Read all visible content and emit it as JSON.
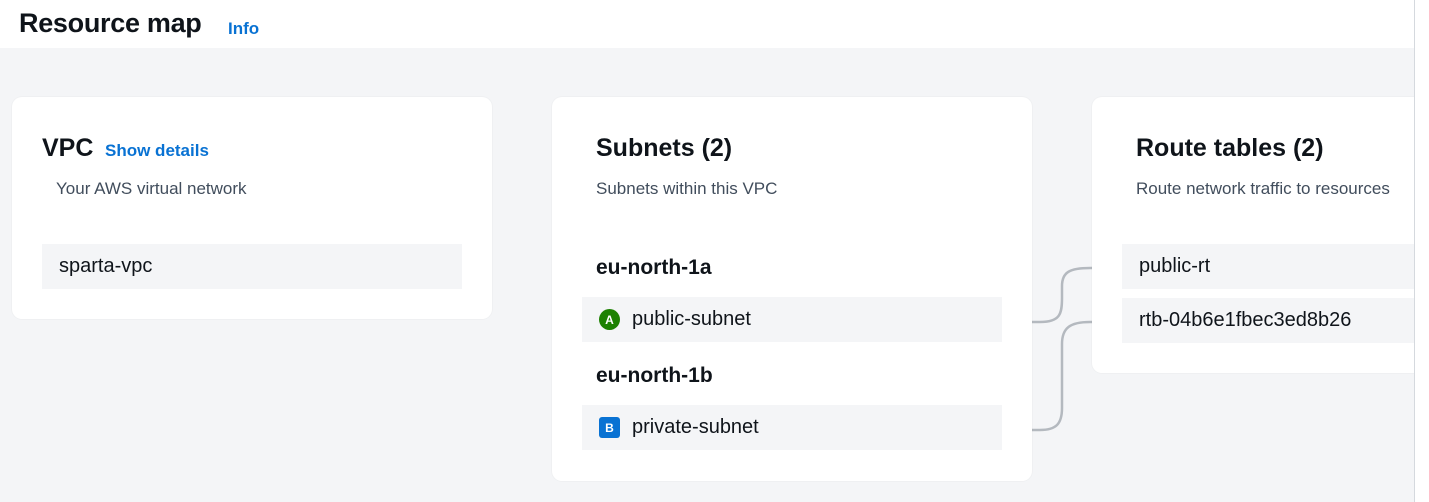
{
  "header": {
    "title": "Resource map",
    "info_link": "Info"
  },
  "vpc_card": {
    "title": "VPC",
    "details_link": "Show details",
    "description": "Your AWS virtual network",
    "vpc_name": "sparta-vpc"
  },
  "subnets_card": {
    "title": "Subnets (2)",
    "description": "Subnets within this VPC",
    "groups": [
      {
        "az": "eu-north-1a",
        "badge": "A",
        "subnet": "public-subnet"
      },
      {
        "az": "eu-north-1b",
        "badge": "B",
        "subnet": "private-subnet"
      }
    ]
  },
  "route_tables_card": {
    "title": "Route tables (2)",
    "description": "Route network traffic to resources",
    "items": [
      "public-rt",
      "rtb-04b6e1fbec3ed8b26"
    ]
  },
  "colors": {
    "link": "#0972d3",
    "az_a": "#1d8102",
    "az_b": "#0972d3",
    "canvas": "#f4f5f7",
    "connector": "#b4b9bf"
  }
}
